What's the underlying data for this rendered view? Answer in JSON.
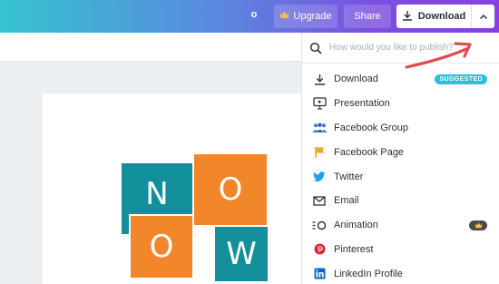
{
  "header": {
    "user_initial": "o",
    "upgrade_label": "Upgrade",
    "share_label": "Share",
    "download_label": "Download"
  },
  "design": {
    "letters": [
      "N",
      "O",
      "O",
      "W"
    ],
    "colors": {
      "teal": "#128f9a",
      "orange": "#f2862a"
    }
  },
  "publish_menu": {
    "search_placeholder": "How would you like to publish?",
    "items": [
      {
        "label": "Download",
        "icon": "download-icon",
        "badge": "SUGGESTED"
      },
      {
        "label": "Presentation",
        "icon": "presentation-icon"
      },
      {
        "label": "Facebook Group",
        "icon": "facebook-group-icon"
      },
      {
        "label": "Facebook Page",
        "icon": "facebook-page-flag-icon"
      },
      {
        "label": "Twitter",
        "icon": "twitter-icon"
      },
      {
        "label": "Email",
        "icon": "email-icon"
      },
      {
        "label": "Animation",
        "icon": "animation-icon",
        "badge_icon": "crown-icon"
      },
      {
        "label": "Pinterest",
        "icon": "pinterest-icon"
      },
      {
        "label": "LinkedIn Profile",
        "icon": "linkedin-icon"
      }
    ]
  },
  "colors": {
    "suggested_badge": "#2bbfe0",
    "accent_arrow": "#e04a52"
  }
}
